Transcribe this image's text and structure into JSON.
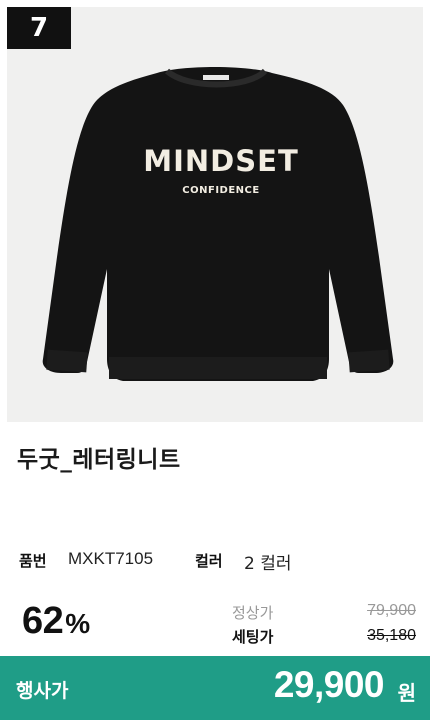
{
  "rank": "7",
  "product": {
    "image_print_main": "MINDSET",
    "image_print_sub": "CONFIDENCE",
    "title": "두굿_레터링니트",
    "code_label": "품번",
    "code_value": "MXKT7105",
    "color_label": "컬러",
    "color_value": "2 컬러"
  },
  "pricing": {
    "discount_number": "62",
    "discount_symbol": "%",
    "regular_label": "정상가",
    "regular_price": "79,900",
    "set_label": "세팅가",
    "set_price": "35,180",
    "event_label": "행사가",
    "event_price": "29,900",
    "event_unit": "원"
  },
  "colors": {
    "accent": "#1f9d87",
    "badge": "#111111",
    "image_bg": "#f0f0ef"
  }
}
